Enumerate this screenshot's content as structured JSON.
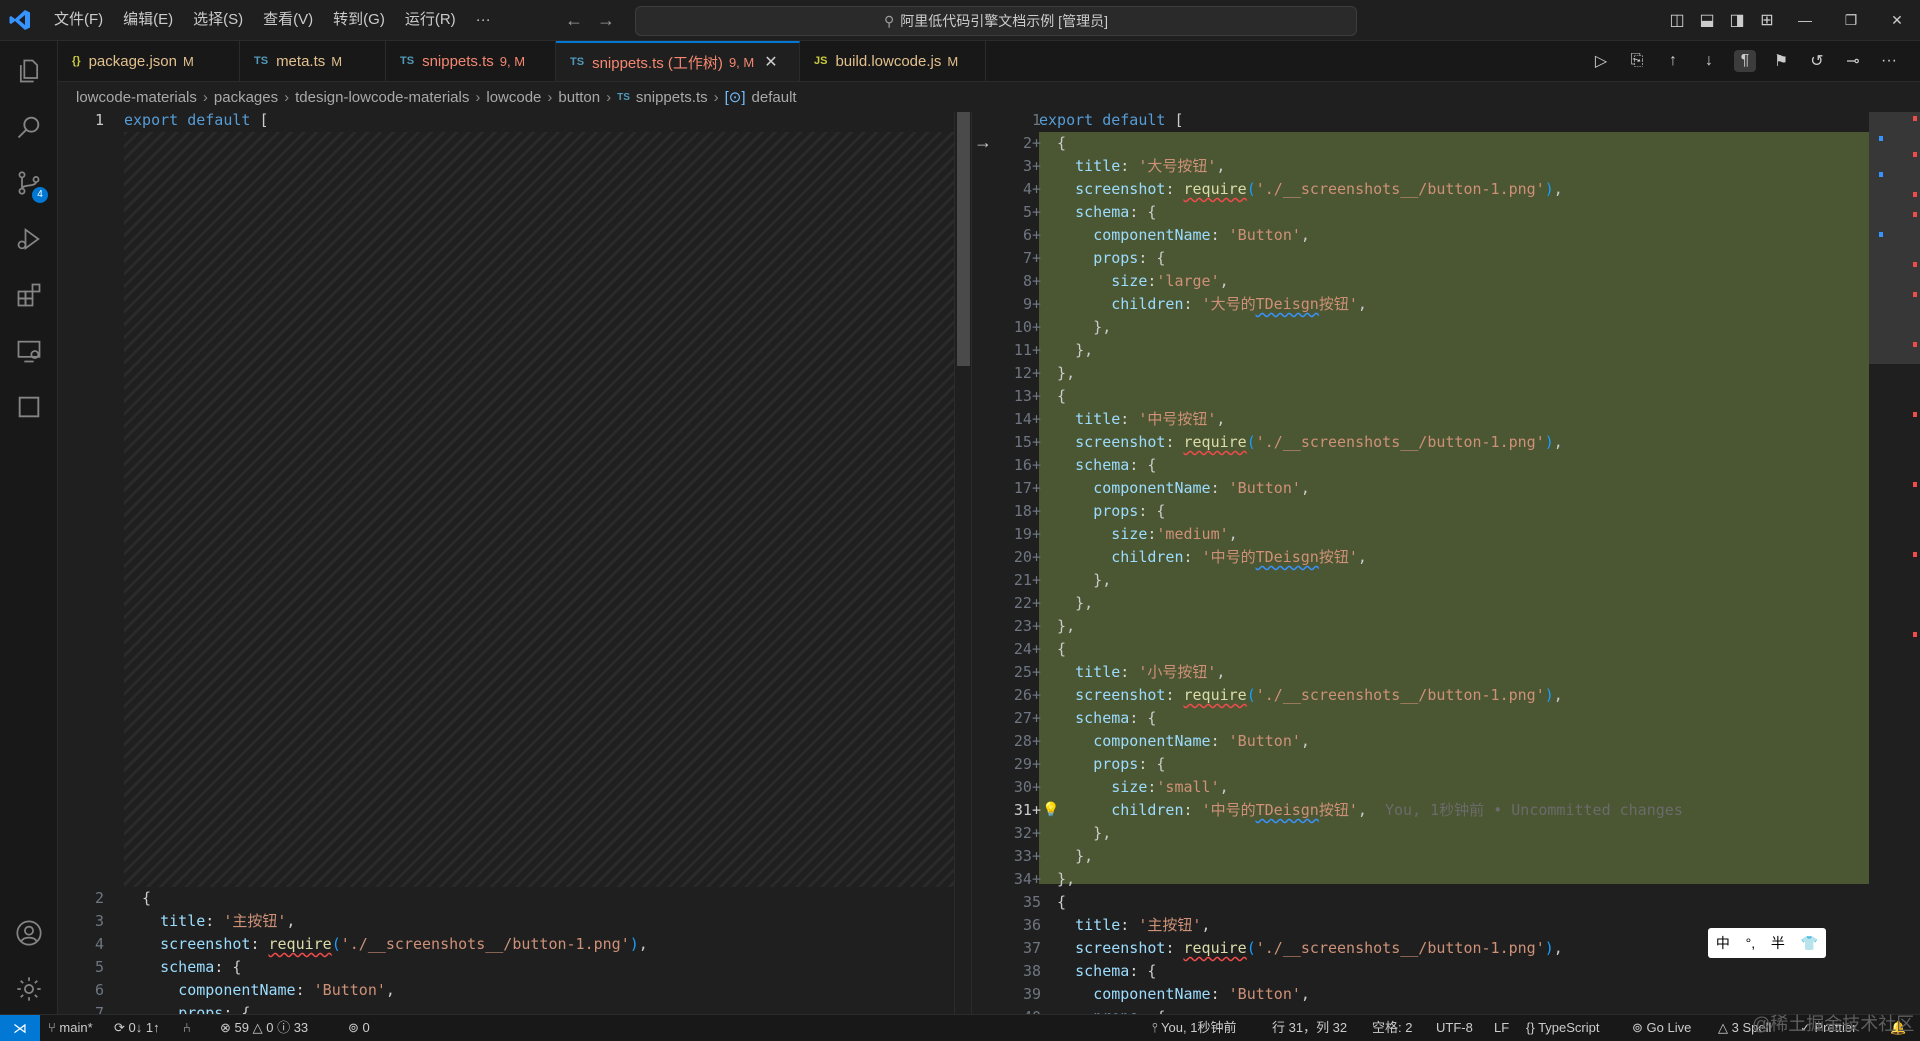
{
  "menu": [
    "文件(F)",
    "编辑(E)",
    "选择(S)",
    "查看(V)",
    "转到(G)",
    "运行(R)",
    "···"
  ],
  "command_center": "阿里低代码引擎文档示例 [管理员]",
  "activity_badge": "4",
  "tabs": [
    {
      "type": "{}",
      "name": "package.json",
      "status": "M"
    },
    {
      "type": "TS",
      "name": "meta.ts",
      "status": "M"
    },
    {
      "type": "TS",
      "name": "snippets.ts",
      "status": "9, M"
    },
    {
      "type": "TS",
      "name": "snippets.ts (工作树)",
      "status": "9, M",
      "close": "✕"
    },
    {
      "type": "JS",
      "name": "build.lowcode.js",
      "status": "M"
    }
  ],
  "breadcrumb": {
    "parts": [
      "lowcode-materials",
      "packages",
      "tdesign-lowcode-materials",
      "lowcode",
      "button"
    ],
    "file_type": "TS",
    "file": "snippets.ts",
    "symbol": "default"
  },
  "left_lines": [
    {
      "n": "1",
      "t": "export default ["
    },
    {
      "n": "2",
      "t": "  {"
    },
    {
      "n": "3",
      "t": "    title: '主按钮',"
    },
    {
      "n": "4",
      "t": "    screenshot: require('./__screenshots__/button-1.png'),"
    },
    {
      "n": "5",
      "t": "    schema: {"
    },
    {
      "n": "6",
      "t": "      componentName: 'Button',"
    },
    {
      "n": "7",
      "t": "      props: {"
    }
  ],
  "right_lines": [
    {
      "n": "1",
      "t": "export default ["
    },
    {
      "n": "2+",
      "t": "  {"
    },
    {
      "n": "3+",
      "t": "    title: '大号按钮',"
    },
    {
      "n": "4+",
      "t": "    screenshot: require('./__screenshots__/button-1.png'),"
    },
    {
      "n": "5+",
      "t": "    schema: {"
    },
    {
      "n": "6+",
      "t": "      componentName: 'Button',"
    },
    {
      "n": "7+",
      "t": "      props: {"
    },
    {
      "n": "8+",
      "t": "        size:'large',"
    },
    {
      "n": "9+",
      "t": "        children: '大号的TDeisgn按钮',"
    },
    {
      "n": "10+",
      "t": "      },"
    },
    {
      "n": "11+",
      "t": "    },"
    },
    {
      "n": "12+",
      "t": "  },"
    },
    {
      "n": "13+",
      "t": "  {"
    },
    {
      "n": "14+",
      "t": "    title: '中号按钮',"
    },
    {
      "n": "15+",
      "t": "    screenshot: require('./__screenshots__/button-1.png'),"
    },
    {
      "n": "16+",
      "t": "    schema: {"
    },
    {
      "n": "17+",
      "t": "      componentName: 'Button',"
    },
    {
      "n": "18+",
      "t": "      props: {"
    },
    {
      "n": "19+",
      "t": "        size:'medium',"
    },
    {
      "n": "20+",
      "t": "        children: '中号的TDeisgn按钮',"
    },
    {
      "n": "21+",
      "t": "      },"
    },
    {
      "n": "22+",
      "t": "    },"
    },
    {
      "n": "23+",
      "t": "  },"
    },
    {
      "n": "24+",
      "t": "  {"
    },
    {
      "n": "25+",
      "t": "    title: '小号按钮',"
    },
    {
      "n": "26+",
      "t": "    screenshot: require('./__screenshots__/button-1.png'),"
    },
    {
      "n": "27+",
      "t": "    schema: {"
    },
    {
      "n": "28+",
      "t": "      componentName: 'Button',"
    },
    {
      "n": "29+",
      "t": "      props: {"
    },
    {
      "n": "30+",
      "t": "        size:'small',"
    },
    {
      "n": "31+",
      "t": "        children: '中号的TDeisgn按钮',"
    },
    {
      "n": "32+",
      "t": "      },"
    },
    {
      "n": "33+",
      "t": "    },"
    },
    {
      "n": "34+",
      "t": "  },"
    },
    {
      "n": "35",
      "t": "  {"
    },
    {
      "n": "36",
      "t": "    title: '主按钮',"
    },
    {
      "n": "37",
      "t": "    screenshot: require('./__screenshots__/button-1.png'),"
    },
    {
      "n": "38",
      "t": "    schema: {"
    },
    {
      "n": "39",
      "t": "      componentName: 'Button',"
    },
    {
      "n": "40",
      "t": "      props: {"
    }
  ],
  "blame": "You, 1秒钟前 • Uncommitted changes",
  "ime": [
    "中",
    "°,",
    "半",
    "👕"
  ],
  "status": {
    "branch": "main*",
    "sync": "0↓ 1↑",
    "errors": "59",
    "warnings": "0",
    "infos": "33",
    "ports": "0",
    "blame": "You, 1秒钟前",
    "position": "行 31，列 32",
    "spaces": "空格: 2",
    "encoding": "UTF-8",
    "eol": "LF",
    "language": "TypeScript",
    "live": "Go Live",
    "spell": "3 Spell",
    "prettier": "Prettier"
  },
  "watermark": "@稀土掘金技术社区",
  "colors": {
    "accent": "#0078d4",
    "inserted": "#4b5632",
    "tab_modified": "#e2c08d"
  }
}
